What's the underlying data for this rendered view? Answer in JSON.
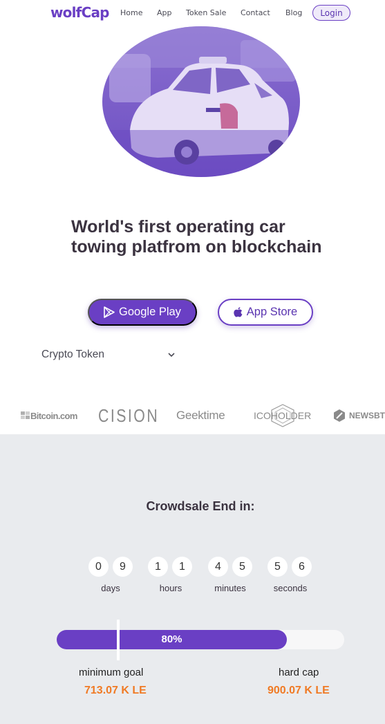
{
  "brand": {
    "logo": "wolfCap",
    "accent": "#6a3fc4",
    "highlight": "#f07a24"
  },
  "nav": {
    "links": [
      "Home",
      "App",
      "Token Sale",
      "Contact",
      "Blog"
    ],
    "login": "Login"
  },
  "hero": {
    "image_icon": "taxi-car-photo",
    "headline": "World's first operating car towing platfrom on blockchain",
    "google_play": "Google Play",
    "app_store": "App Store",
    "dropdown_value": "Crypto Token"
  },
  "partners": [
    "Bitcoin.com",
    "CISION",
    "Geektime",
    "ICOHOLDER",
    "NEWSBT"
  ],
  "crowdsale": {
    "title": "Crowdsale End in:",
    "digits": [
      "0",
      "9",
      "1",
      "1",
      "4",
      "5",
      "5",
      "6"
    ],
    "units": [
      "days",
      "hours",
      "minutes",
      "seconds"
    ],
    "progress_label": "80%",
    "progress_value": 0.8,
    "min_goal_fraction": 0.21,
    "min_label": "minimum goal",
    "min_value": "713.07 K LE",
    "max_label": "hard cap",
    "max_value": "900.07 K LE"
  }
}
